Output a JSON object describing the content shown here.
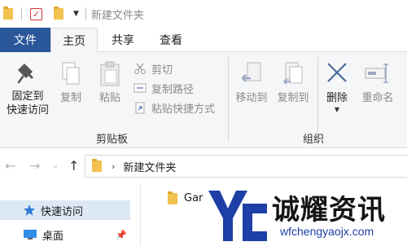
{
  "window": {
    "title": "新建文件夹"
  },
  "tabs": {
    "file": "文件",
    "home": "主页",
    "share": "共享",
    "view": "查看"
  },
  "ribbon": {
    "clipboard": {
      "group_label": "剪贴板",
      "pin": "固定到\n快速访问",
      "copy": "复制",
      "paste": "粘贴",
      "cut": "剪切",
      "copy_path": "复制路径",
      "paste_shortcut": "粘贴快捷方式"
    },
    "organize": {
      "group_label": "组织",
      "move_to": "移动到",
      "copy_to": "复制到",
      "delete": "删除",
      "rename": "重命名"
    }
  },
  "address": {
    "path": "新建文件夹"
  },
  "nav": {
    "items": [
      {
        "label": "快速访问",
        "icon": "star-icon",
        "selected": true
      },
      {
        "label": "桌面",
        "icon": "desktop-icon",
        "selected": false
      }
    ]
  },
  "files": [
    {
      "name": "Gar"
    }
  ],
  "watermark": {
    "title": "诚耀资讯",
    "url": "wfchengyaojx.com",
    "accent": "#1d3fa6"
  },
  "colors": {
    "file_tab": "#2a579a",
    "ribbon_bg": "#f5f6f7",
    "folder": "#f2c14e",
    "delete_accent": "#1d5bb8"
  }
}
